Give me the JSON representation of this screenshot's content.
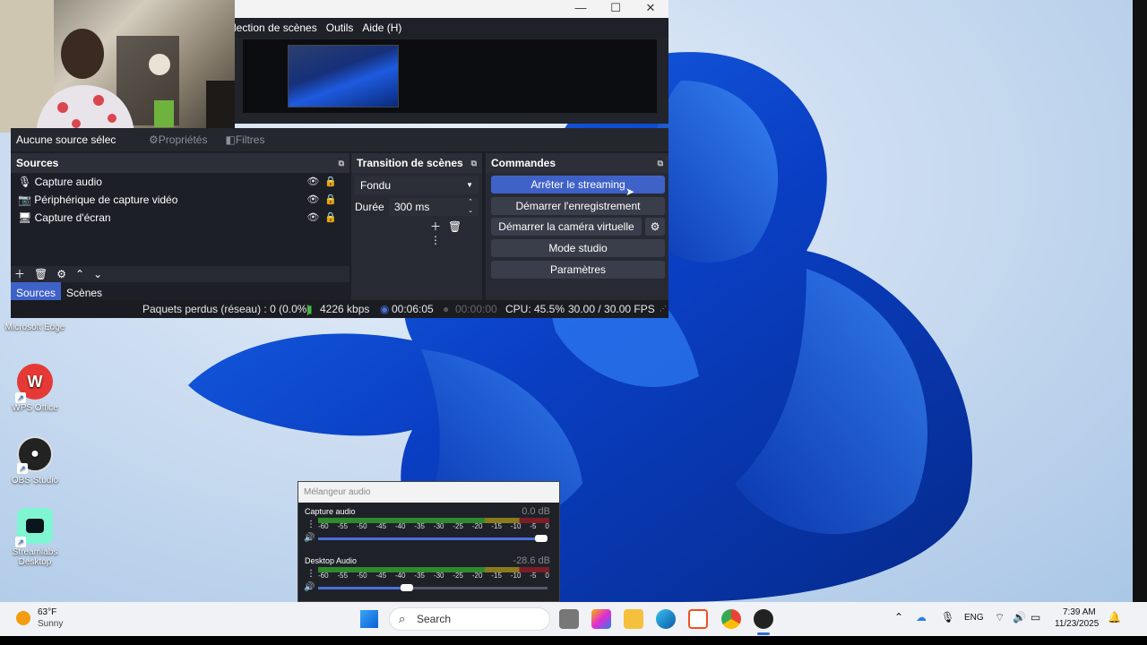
{
  "obs": {
    "menu": [
      "lection de scènes",
      "Outils",
      "Aide (H)"
    ],
    "source_toolbar": {
      "no_source": "Aucune source sélec",
      "properties": "Propriétés",
      "filters": "Filtres"
    },
    "sources_dock": {
      "title": "Sources",
      "items": [
        {
          "label": "Capture audio",
          "icon": "microphone-icon"
        },
        {
          "label": "Périphérique de capture vidéo",
          "icon": "camera-icon"
        },
        {
          "label": "Capture d'écran",
          "icon": "monitor-icon"
        }
      ],
      "tabs": [
        "Sources",
        "Scènes"
      ]
    },
    "transitions_dock": {
      "title": "Transition de scènes",
      "selected": "Fondu",
      "duration_label": "Durée",
      "duration_value": "300 ms"
    },
    "commands_dock": {
      "title": "Commandes",
      "stop_streaming": "Arrêter le streaming",
      "start_recording": "Démarrer l'enregistrement",
      "start_virtual_camera": "Démarrer la caméra virtuelle",
      "studio_mode": "Mode studio",
      "settings": "Paramètres"
    },
    "status": {
      "dropped_frames": "Paquets perdus (réseau) : 0 (0.0%)",
      "bitrate": "4226 kbps",
      "stream_time": "00:06:05",
      "record_time": "00:00:00",
      "cpu": "CPU: 45.5%",
      "fps": "30.00 / 30.00 FPS"
    }
  },
  "mixer": {
    "title": "Mélangeur audio",
    "scale": [
      "-60",
      "-55",
      "-50",
      "-45",
      "-40",
      "-35",
      "-30",
      "-25",
      "-20",
      "-15",
      "-10",
      "-5",
      "0"
    ],
    "channels": [
      {
        "name": "Capture audio",
        "db": "0.0 dB",
        "volume": 1.0
      },
      {
        "name": "Desktop Audio",
        "db": "-28.6 dB",
        "volume": 0.38
      }
    ]
  },
  "desktop_icons": [
    {
      "label": "Microsoft Edge",
      "icon": "edge-icon"
    },
    {
      "label": "WPS Office",
      "icon": "wps-office-icon"
    },
    {
      "label": "OBS Studio",
      "icon": "obs-studio-icon"
    },
    {
      "label": "Streamlabs Desktop",
      "icon": "streamlabs-icon"
    }
  ],
  "taskbar": {
    "weather_temp": "63°F",
    "weather_desc": "Sunny",
    "search_placeholder": "Search",
    "lang": "ENG",
    "time": "7:39 AM",
    "date": "11/23/2025"
  },
  "colors": {
    "obs_accent": "#3f62c9",
    "wallpaper_blue": "#1e5be0",
    "taskbar": "#f1f2f6"
  }
}
